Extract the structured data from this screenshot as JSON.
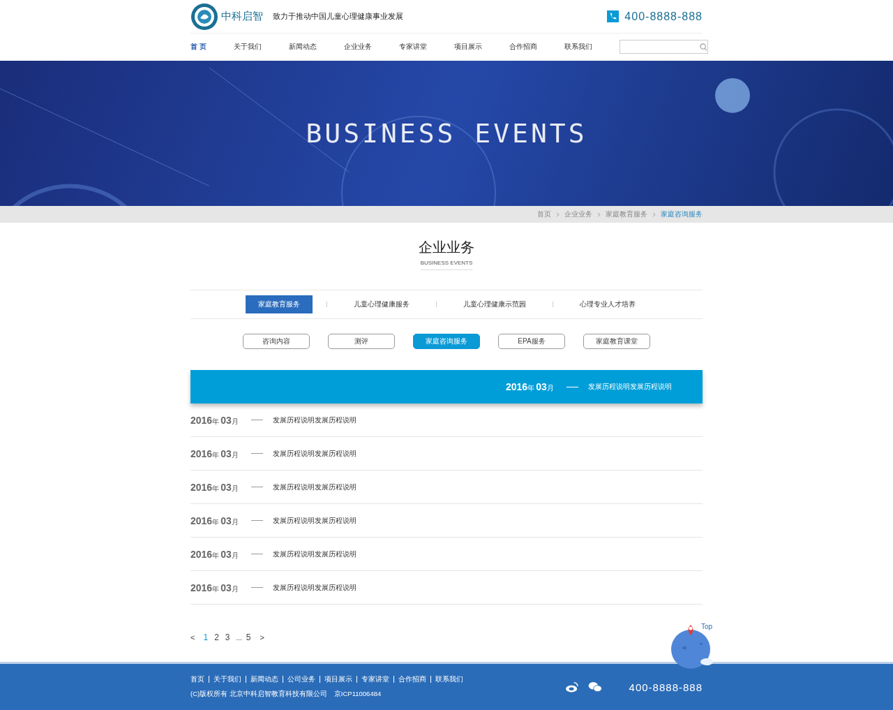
{
  "header": {
    "brand": "中科启智",
    "slogan": "致力于推动中国儿童心理健康事业发展",
    "phone": "400-8888-888"
  },
  "nav": [
    {
      "label": "首 页",
      "selected": true
    },
    {
      "label": "关于我们",
      "selected": false
    },
    {
      "label": "新闻动态",
      "selected": false
    },
    {
      "label": "企业业务",
      "selected": false
    },
    {
      "label": "专家讲堂",
      "selected": false
    },
    {
      "label": "项目展示",
      "selected": false
    },
    {
      "label": "合作招商",
      "selected": false
    },
    {
      "label": "联系我们",
      "selected": false
    }
  ],
  "banner": {
    "title": "BUSINESS EVENTS"
  },
  "breadcrumb": [
    {
      "label": "首页",
      "selected": false
    },
    {
      "label": "企业业务",
      "selected": false
    },
    {
      "label": "家庭教育服务",
      "selected": false
    },
    {
      "label": "家庭咨询服务",
      "selected": true
    }
  ],
  "section": {
    "title": "企业业务",
    "subtitle": "BUSINESS EVENTS"
  },
  "tabs": [
    {
      "label": "家庭教育服务",
      "selected": true
    },
    {
      "label": "儿童心理健康服务",
      "selected": false
    },
    {
      "label": "儿童心理健康示范园",
      "selected": false
    },
    {
      "label": "心理专业人才培养",
      "selected": false
    }
  ],
  "subtabs": [
    {
      "label": "咨询内容",
      "selected": false
    },
    {
      "label": "测评",
      "selected": false
    },
    {
      "label": "家庭咨询服务",
      "selected": true
    },
    {
      "label": "EPA服务",
      "selected": false
    },
    {
      "label": "家庭教育课堂",
      "selected": false
    }
  ],
  "timeline": [
    {
      "year": "2016",
      "year_unit": "年",
      "month": "03",
      "month_unit": "月",
      "text": "发展历程说明发展历程说明",
      "selected": true
    },
    {
      "year": "2016",
      "year_unit": "年",
      "month": "03",
      "month_unit": "月",
      "text": "发展历程说明发展历程说明",
      "selected": false
    },
    {
      "year": "2016",
      "year_unit": "年",
      "month": "03",
      "month_unit": "月",
      "text": "发展历程说明发展历程说明",
      "selected": false
    },
    {
      "year": "2016",
      "year_unit": "年",
      "month": "03",
      "month_unit": "月",
      "text": "发展历程说明发展历程说明",
      "selected": false
    },
    {
      "year": "2016",
      "year_unit": "年",
      "month": "03",
      "month_unit": "月",
      "text": "发展历程说明发展历程说明",
      "selected": false
    },
    {
      "year": "2016",
      "year_unit": "年",
      "month": "03",
      "month_unit": "月",
      "text": "发展历程说明发展历程说明",
      "selected": false
    },
    {
      "year": "2016",
      "year_unit": "年",
      "month": "03",
      "month_unit": "月",
      "text": "发展历程说明发展历程说明",
      "selected": false
    }
  ],
  "pagination": [
    {
      "kind": "prev",
      "label": "<",
      "selected": false
    },
    {
      "kind": "page",
      "label": "1",
      "selected": true
    },
    {
      "kind": "page",
      "label": "2",
      "selected": false
    },
    {
      "kind": "page",
      "label": "3",
      "selected": false
    },
    {
      "kind": "gap",
      "label": "...",
      "selected": false
    },
    {
      "kind": "page",
      "label": "5",
      "selected": false
    },
    {
      "kind": "next",
      "label": ">",
      "selected": false
    }
  ],
  "back_to_top": {
    "label": "Top"
  },
  "footer": {
    "links": [
      "首页",
      "关于我们",
      "新闻动态",
      "公司业务",
      "项目展示",
      "专家讲堂",
      "合作招商",
      "联系我们"
    ],
    "copyright": "(C)版权所有 北京中科启智教育科技有限公司",
    "icp": "京ICP11006484",
    "phone": "400-8888-888"
  }
}
